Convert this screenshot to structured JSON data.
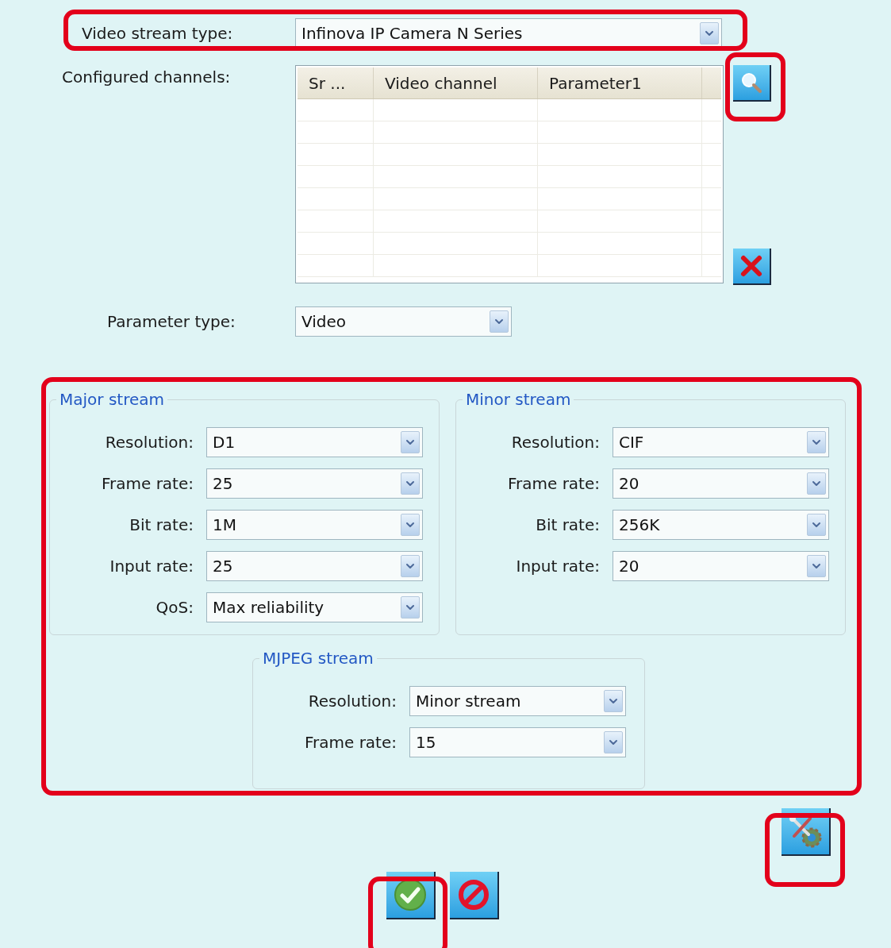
{
  "video_stream_type": {
    "label": "Video stream type:",
    "value": "Infinova IP Camera N Series"
  },
  "configured_channels": {
    "label": "Configured channels:",
    "columns": [
      "Sr ...",
      "Video channel",
      "Parameter1"
    ]
  },
  "parameter_type": {
    "label": "Parameter type:",
    "value": "Video"
  },
  "stream_groups": [
    {
      "title": "Major stream",
      "fields": [
        {
          "label": "Resolution:",
          "value": "D1"
        },
        {
          "label": "Frame rate:",
          "value": "25"
        },
        {
          "label": "Bit rate:",
          "value": "1M"
        },
        {
          "label": "Input rate:",
          "value": "25"
        },
        {
          "label": "QoS:",
          "value": "Max reliability"
        }
      ]
    },
    {
      "title": "Minor stream",
      "fields": [
        {
          "label": "Resolution:",
          "value": "CIF"
        },
        {
          "label": "Frame rate:",
          "value": "20"
        },
        {
          "label": "Bit rate:",
          "value": "256K"
        },
        {
          "label": "Input rate:",
          "value": "20"
        }
      ]
    },
    {
      "title": "MJPEG stream",
      "fields": [
        {
          "label": "Resolution:",
          "value": "Minor stream"
        },
        {
          "label": "Frame rate:",
          "value": "15"
        }
      ]
    }
  ]
}
